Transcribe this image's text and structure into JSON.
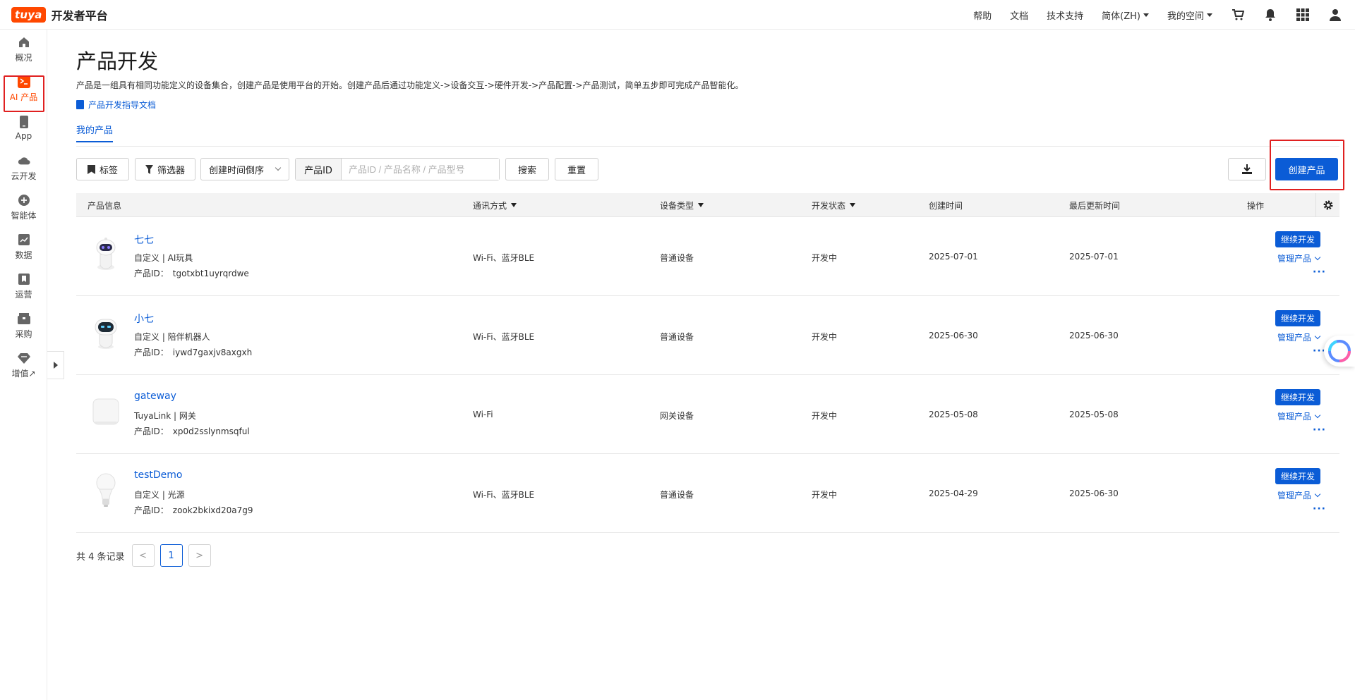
{
  "brand": {
    "logo_text": "tuya",
    "title": "开发者平台",
    "accent": "#ff4800",
    "primary": "#0b5cd6"
  },
  "top_nav": {
    "help": "帮助",
    "docs": "文档",
    "support": "技术支持",
    "language": "简体(ZH)",
    "workspace": "我的空间",
    "icons": [
      "cart-icon",
      "bell-icon",
      "apps-grid-icon",
      "user-icon"
    ]
  },
  "sidebar": {
    "items": [
      {
        "label": "概况",
        "icon": "home-icon"
      },
      {
        "label": "AI 产品",
        "icon": "terminal-icon",
        "active": true
      },
      {
        "label": "App",
        "icon": "phone-icon"
      },
      {
        "label": "云开发",
        "icon": "cloud-icon"
      },
      {
        "label": "智能体",
        "icon": "plus-circle-icon"
      },
      {
        "label": "数据",
        "icon": "chart-icon"
      },
      {
        "label": "运营",
        "icon": "bookmark-icon"
      },
      {
        "label": "采购",
        "icon": "box-icon"
      },
      {
        "label": "增值↗",
        "icon": "diamond-icon"
      }
    ]
  },
  "page": {
    "title": "产品开发",
    "description": "产品是一组具有相同功能定义的设备集合，创建产品是使用平台的开始。创建产品后通过功能定义->设备交互->硬件开发->产品配置->产品测试，简单五步即可完成产品智能化。",
    "guide_link": "产品开发指导文档",
    "tab": "我的产品"
  },
  "toolbar": {
    "tag_button": "标签",
    "filter_button": "筛选器",
    "sort_select": "创建时间倒序",
    "search_label": "产品ID",
    "search_placeholder": "产品ID / 产品名称 / 产品型号",
    "search_button": "搜索",
    "reset_button": "重置",
    "create_button": "创建产品"
  },
  "table": {
    "headers": {
      "info": "产品信息",
      "protocol": "通讯方式",
      "device_type": "设备类型",
      "status": "开发状态",
      "created": "创建时间",
      "updated": "最后更新时间",
      "action": "操作"
    },
    "id_prefix": "产品ID：",
    "continue_label": "继续开发",
    "manage_label": "管理产品",
    "more_label": "···",
    "rows": [
      {
        "name": "七七",
        "sub": "自定义  |  AI玩具",
        "id": "tgotxbt1uyrqrdwe",
        "protocol": "Wi-Fi、蓝牙BLE",
        "device_type": "普通设备",
        "status": "开发中",
        "created": "2025-07-01",
        "updated": "2025-07-01",
        "thumb": "robot-white-icon"
      },
      {
        "name": "小七",
        "sub": "自定义  |  陪伴机器人",
        "id": "iywd7gaxjv8axgxh",
        "protocol": "Wi-Fi、蓝牙BLE",
        "device_type": "普通设备",
        "status": "开发中",
        "created": "2025-06-30",
        "updated": "2025-06-30",
        "thumb": "robot-dark-face-icon"
      },
      {
        "name": "gateway",
        "sub": "TuyaLink  |  网关",
        "id": "xp0d2sslynmsqful",
        "protocol": "Wi-Fi",
        "device_type": "网关设备",
        "status": "开发中",
        "created": "2025-05-08",
        "updated": "2025-05-08",
        "thumb": "gateway-box-icon"
      },
      {
        "name": "testDemo",
        "sub": "自定义  |  光源",
        "id": "zook2bkixd20a7g9",
        "protocol": "Wi-Fi、蓝牙BLE",
        "device_type": "普通设备",
        "status": "开发中",
        "created": "2025-04-29",
        "updated": "2025-06-30",
        "thumb": "light-bulb-icon"
      }
    ]
  },
  "pagination": {
    "total": "共 4 条记录",
    "current": "1",
    "prev": "<",
    "next": ">"
  }
}
